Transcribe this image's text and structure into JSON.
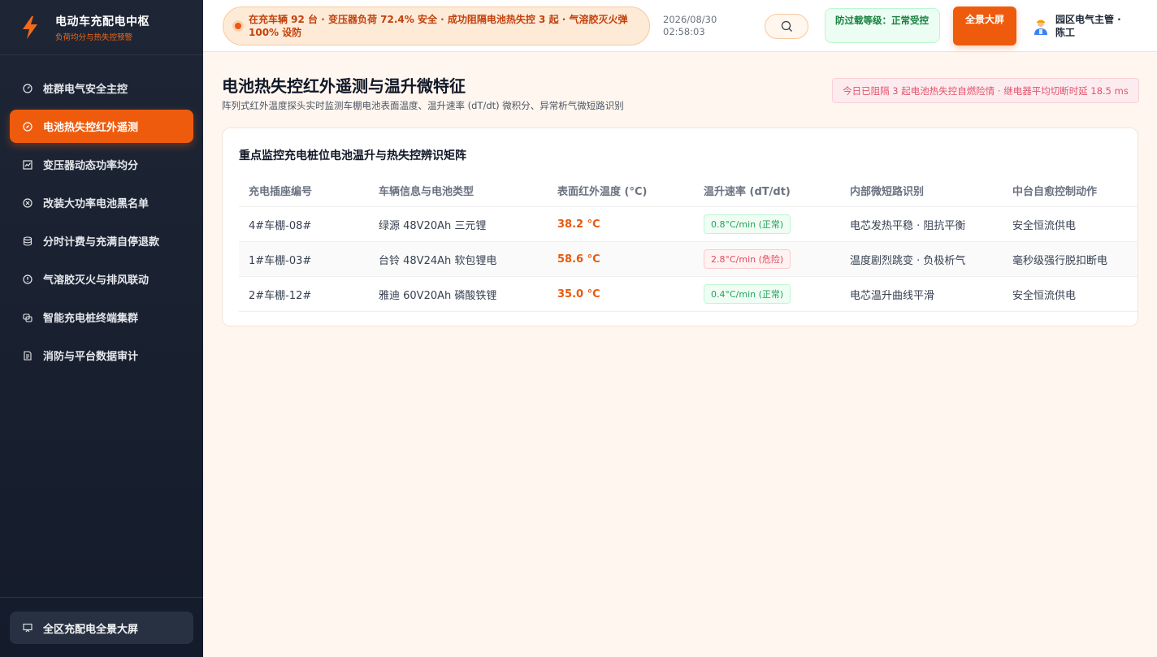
{
  "brand": {
    "title": "电动车充配电中枢",
    "subtitle": "负荷均分与热失控预警"
  },
  "nav": {
    "items": [
      {
        "label": "桩群电气安全主控",
        "icon": "gauge-icon"
      },
      {
        "label": "电池热失控红外遥测",
        "icon": "compass-icon"
      },
      {
        "label": "变压器动态功率均分",
        "icon": "chart-icon"
      },
      {
        "label": "改装大功率电池黑名单",
        "icon": "ban-icon"
      },
      {
        "label": "分时计费与充满自停退款",
        "icon": "database-icon"
      },
      {
        "label": "气溶胶灭火与排风联动",
        "icon": "alert-icon"
      },
      {
        "label": "智能充电桩终端集群",
        "icon": "layers-icon"
      },
      {
        "label": "消防与平台数据审计",
        "icon": "document-icon"
      }
    ],
    "active_index": 1
  },
  "sidebar_bottom": {
    "label": "全区充配电全景大屏",
    "icon": "monitor-icon"
  },
  "header": {
    "status_text": "在充车辆 92 台 · 变压器负荷 72.4% 安全 · 成功阻隔电池热失控 3 起 · 气溶胶灭火弹 100% 设防",
    "date": "2026/08/30",
    "time": "02:58:03",
    "protect_level": "防过载等级：正常受控",
    "fullscreen_label": "全景大屏",
    "user_name": "园区电气主管 · 陈工"
  },
  "page": {
    "title": "电池热失控红外遥测与温升微特征",
    "description": "阵列式红外温度探头实时监测车棚电池表面温度、温升速率 (dT/dt) 微积分、异常析气微短路识别",
    "alert": "今日已阻隔 3 起电池热失控自燃险情 · 继电器平均切断时延 18.5 ms"
  },
  "table": {
    "title": "重点监控充电桩位电池温升与热失控辨识矩阵",
    "headers": [
      "充电插座编号",
      "车辆信息与电池类型",
      "表面红外温度 (°C)",
      "温升速率 (dT/dt)",
      "内部微短路识别",
      "中台自愈控制动作"
    ],
    "rows": [
      {
        "socket": "4#车棚-08#",
        "vehicle": "绿源 48V20Ah 三元锂",
        "temp": "38.2 °C",
        "rate": "0.8°C/min (正常)",
        "rate_status": "ok",
        "short": "电芯发热平稳 · 阻抗平衡",
        "action": "安全恒流供电"
      },
      {
        "socket": "1#车棚-03#",
        "vehicle": "台铃 48V24Ah 软包锂电",
        "temp": "58.6 °C",
        "rate": "2.8°C/min (危险)",
        "rate_status": "danger",
        "short": "温度剧烈跳变 · 负极析气",
        "action": "毫秒级强行脱扣断电"
      },
      {
        "socket": "2#车棚-12#",
        "vehicle": "雅迪 60V20Ah 磷酸铁锂",
        "temp": "35.0 °C",
        "rate": "0.4°C/min (正常)",
        "rate_status": "ok",
        "short": "电芯温升曲线平滑",
        "action": "安全恒流供电"
      }
    ]
  },
  "colors": {
    "accent": "#ee5b0d",
    "sidebar_bg": "#1a2233",
    "ok": "#22a35a",
    "danger": "#e04b5c"
  }
}
